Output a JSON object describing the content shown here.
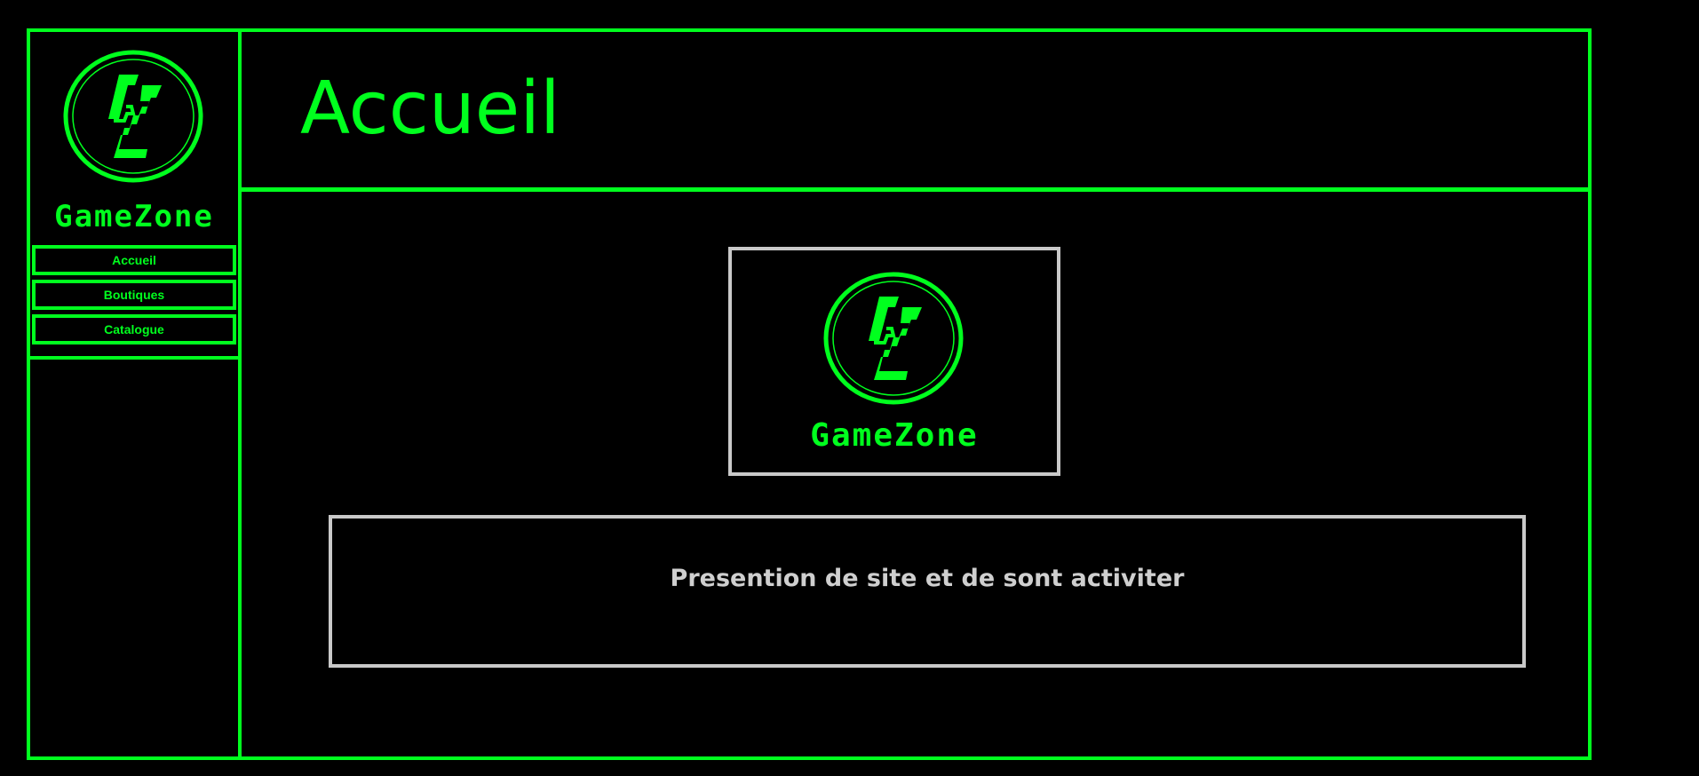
{
  "brand": {
    "name": "GameZone",
    "logo_icon": "gz-circle-logo",
    "accent_color": "#00ff1e"
  },
  "nav": {
    "items": [
      {
        "label": "Accueil"
      },
      {
        "label": "Boutiques"
      },
      {
        "label": "Catalogue"
      }
    ]
  },
  "header": {
    "title": "Accueil"
  },
  "main": {
    "hero_brand": "GameZone",
    "presentation": "Presention de site et de sont activiter"
  }
}
